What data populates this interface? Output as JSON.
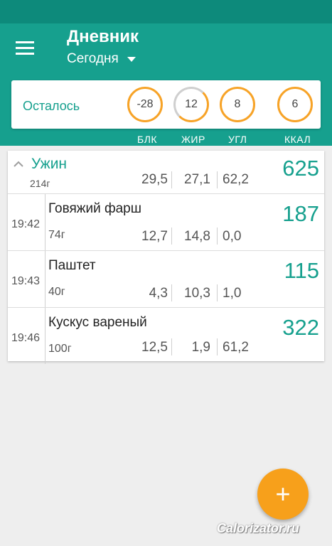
{
  "header": {
    "title": "Дневник",
    "period": "Сегодня"
  },
  "summary": {
    "label": "Осталось",
    "values": [
      "-28",
      "12",
      "8",
      "6"
    ],
    "columns": [
      "БЛК",
      "ЖИР",
      "УГЛ",
      "ККАЛ"
    ]
  },
  "meal": {
    "name": "Ужин",
    "weight": "214г",
    "protein": "29,5",
    "fat": "27,1",
    "carbs": "62,2",
    "kcal": "625"
  },
  "items": [
    {
      "time": "19:42",
      "name": "Говяжий фарш",
      "weight": "74г",
      "protein": "12,7",
      "fat": "14,8",
      "carbs": "0,0",
      "kcal": "187"
    },
    {
      "time": "19:43",
      "name": "Паштет",
      "weight": "40г",
      "protein": "4,3",
      "fat": "10,3",
      "carbs": "1,0",
      "kcal": "115"
    },
    {
      "time": "19:46",
      "name": "Кускус вареный",
      "weight": "100г",
      "protein": "12,5",
      "fat": "1,9",
      "carbs": "61,2",
      "kcal": "322"
    }
  ],
  "fab": {
    "label": "+"
  },
  "watermark": "Calorizator.ru",
  "colors": {
    "primary": "#16a08e",
    "primary_dark": "#0d8a7b",
    "accent": "#f7a01b"
  }
}
